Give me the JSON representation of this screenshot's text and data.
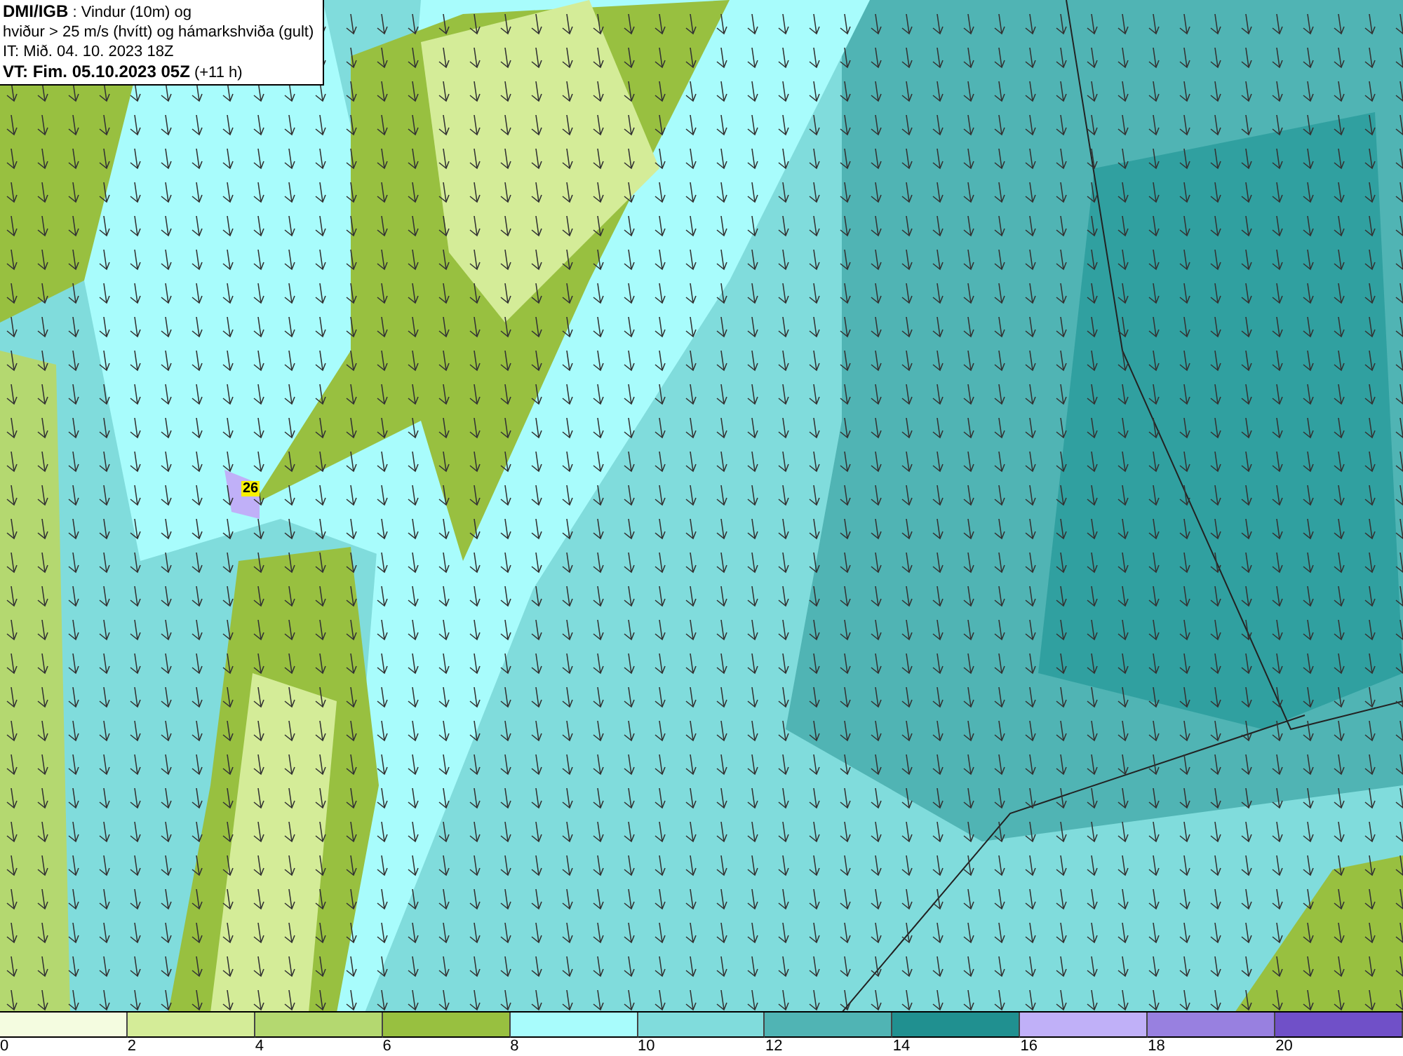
{
  "info_box": {
    "lines": [
      "**DMI/IGB** : Vindur (10m) og",
      "hviður > 25 m/s (hvítt) og hámarkshviða (gult)",
      "IT: Mið. 04. 10. 2023 18Z",
      "**VT: Fim. 05.10.2023 05Z** (+11 h)"
    ]
  },
  "map": {
    "max_gust_label": "26"
  },
  "legend": [
    {
      "color": "#f4fce0",
      "label": "0"
    },
    {
      "color": "#d4ec98",
      "label": "2"
    },
    {
      "color": "#b4d870",
      "label": "4"
    },
    {
      "color": "#98c040",
      "label": "6"
    },
    {
      "color": "#a8fcfc",
      "label": "8"
    },
    {
      "color": "#80dcdc",
      "label": "10"
    },
    {
      "color": "#50b4b4",
      "label": "12"
    },
    {
      "color": "#209090",
      "label": "14"
    },
    {
      "color": "#c0b0f8",
      "label": "16"
    },
    {
      "color": "#9880e0",
      "label": "18"
    },
    {
      "color": "#7050c8",
      "label": "20"
    }
  ]
}
